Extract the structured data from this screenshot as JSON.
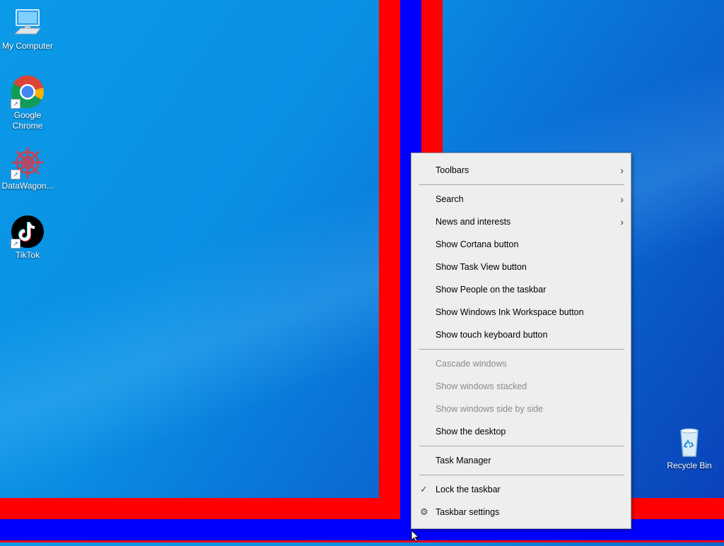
{
  "colors": {
    "red": "#ff0000",
    "blue": "#0000ff",
    "menu_bg": "#eeeeee"
  },
  "desktop": {
    "icons": [
      {
        "label": "My Computer",
        "icon": "computer-icon"
      },
      {
        "label": "Google Chrome",
        "icon": "chrome-icon"
      },
      {
        "label": "DataWagon...",
        "icon": "datawagon-icon"
      },
      {
        "label": "TikTok",
        "icon": "tiktok-icon"
      },
      {
        "label": "Recycle Bin",
        "icon": "recycle-bin-icon"
      }
    ]
  },
  "context_menu": {
    "items": [
      {
        "label": "Toolbars",
        "submenu": true,
        "enabled": true
      },
      {
        "label": "Search",
        "submenu": true,
        "enabled": true
      },
      {
        "label": "News and interests",
        "submenu": true,
        "enabled": true
      },
      {
        "label": "Show Cortana button",
        "enabled": true
      },
      {
        "label": "Show Task View button",
        "enabled": true
      },
      {
        "label": "Show People on the taskbar",
        "enabled": true
      },
      {
        "label": "Show Windows Ink Workspace button",
        "enabled": true
      },
      {
        "label": "Show touch keyboard button",
        "enabled": true
      },
      {
        "label": "Cascade windows",
        "enabled": false
      },
      {
        "label": "Show windows stacked",
        "enabled": false
      },
      {
        "label": "Show windows side by side",
        "enabled": false
      },
      {
        "label": "Show the desktop",
        "enabled": true
      },
      {
        "label": "Task Manager",
        "enabled": true
      },
      {
        "label": "Lock the taskbar",
        "checked": true,
        "enabled": true
      },
      {
        "label": "Taskbar settings",
        "icon": "gear-icon",
        "enabled": true
      }
    ]
  }
}
